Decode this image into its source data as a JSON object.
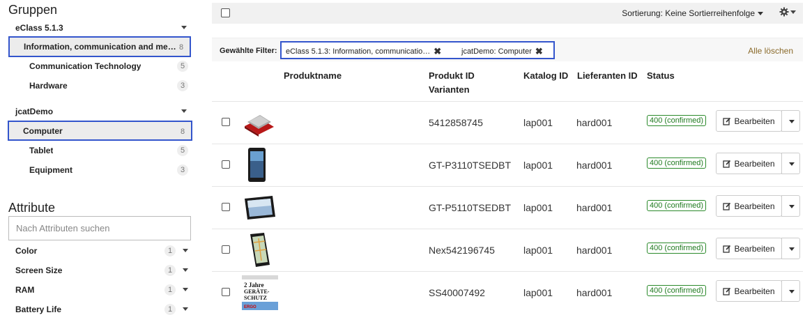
{
  "sidebar": {
    "groups_title": "Gruppen",
    "groups": [
      {
        "label": "eClass 5.1.3",
        "items": [
          {
            "label": "Information, communication and media ...",
            "count": "8"
          },
          {
            "label": "Communication Technology",
            "count": "5"
          },
          {
            "label": "Hardware",
            "count": "3"
          }
        ]
      },
      {
        "label": "jcatDemo",
        "items": [
          {
            "label": "Computer",
            "count": "8"
          },
          {
            "label": "Tablet",
            "count": "5"
          },
          {
            "label": "Equipment",
            "count": "3"
          }
        ]
      }
    ],
    "attributes_title": "Attribute",
    "attribute_search_placeholder": "Nach Attributen suchen",
    "attributes": [
      {
        "label": "Color",
        "count": "1"
      },
      {
        "label": "Screen Size",
        "count": "1"
      },
      {
        "label": "RAM",
        "count": "1"
      },
      {
        "label": "Battery Life",
        "count": "1"
      }
    ]
  },
  "toolbar": {
    "sort_label": "Sortierung: Keine Sortierreihenfolge"
  },
  "filters": {
    "label": "Gewählte Filter:",
    "chips": [
      {
        "label": "eClass 5.1.3: Information, communicatio…"
      },
      {
        "label": "jcatDemo: Computer"
      }
    ],
    "clear_all": "Alle löschen"
  },
  "table": {
    "headers": {
      "name": "Produktname",
      "product_id": "Produkt ID",
      "variants": "Varianten",
      "catalog_id": "Katalog ID",
      "supplier_id": "Lieferanten ID",
      "status": "Status"
    },
    "rows": [
      {
        "product_id": "5412858745",
        "catalog_id": "lap001",
        "supplier_id": "hard001",
        "status": "400 (confirmed)",
        "image": "red-tablet-case"
      },
      {
        "product_id": "GT-P3110TSEDBT",
        "catalog_id": "lap001",
        "supplier_id": "hard001",
        "status": "400 (confirmed)",
        "image": "tablet-portrait"
      },
      {
        "product_id": "GT-P5110TSEDBT",
        "catalog_id": "lap001",
        "supplier_id": "hard001",
        "status": "400 (confirmed)",
        "image": "tablet-landscape"
      },
      {
        "product_id": "Nex542196745",
        "catalog_id": "lap001",
        "supplier_id": "hard001",
        "status": "400 (confirmed)",
        "image": "tablet-map"
      },
      {
        "product_id": "SS40007492",
        "catalog_id": "lap001",
        "supplier_id": "hard001",
        "status": "400 (confirmed)",
        "image": "protection-card"
      }
    ],
    "edit_label": "Bearbeiten",
    "warranty_card": {
      "line1": "2 Jahre",
      "line2": "GERÄTE-",
      "line3": "SCHUTZ",
      "brand": "ERGO"
    }
  }
}
